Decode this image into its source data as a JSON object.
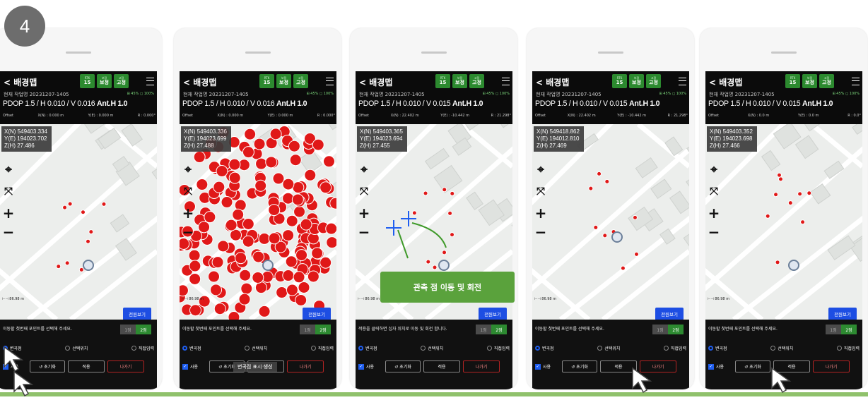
{
  "step_number": "4",
  "header": {
    "back_label": "< 배경맵",
    "chips": [
      {
        "top": "RTK",
        "value": "15"
      },
      {
        "top": "보정",
        "value": "보정"
      },
      {
        "top": "고정",
        "value": "고정"
      }
    ],
    "job_name": "현재 작업명 20231207-1405",
    "status_right": "⊞ 45%  ◻ 100%"
  },
  "panel": {
    "instruction": "이동할 첫번째 포인트를 선택해 주세요.",
    "instruction_alt": "적용을 클릭하면 십자 위치로 이동 및 회전 합니다.",
    "seg_1": "1점",
    "seg_2": "2점",
    "radio_1": "변곡점",
    "radio_2": "선택위치",
    "radio_3": "직접입력",
    "use_label": "사용",
    "reset_label": "↺ 초기화",
    "apply_label": "적용",
    "exit_label": "나가기"
  },
  "map": {
    "scale_text": "⊢⊣ 86.98 m",
    "full_view_label": "전원보기"
  },
  "annotation": {
    "move_rotate": "관측 점 이동 및 회전",
    "toast": "변곡점 표시 생성"
  },
  "screens": [
    {
      "pdop": "PDOP 1.5 / H 0.010 / V 0.016",
      "ant": "Ant.H 1.0",
      "offset": [
        "Offset",
        "X(N) : 0.000 m",
        "Y(E) : 0.000 m",
        "R : 0.000°"
      ],
      "coord": [
        "X(N) 549403.334",
        "Y(E) 194023.702",
        "Z(H) 27.486"
      ]
    },
    {
      "pdop": "PDOP 1.5 / H 0.010 / V 0.016",
      "ant": "Ant.H 1.0",
      "offset": [
        "Offset",
        "X(N) : 0.000 m",
        "Y(E) : 0.000 m",
        "R : 0.000°"
      ],
      "coord": [
        "X(N) 549403.336",
        "Y(E) 194023.699",
        "Z(H) 27.488"
      ]
    },
    {
      "pdop": "PDOP 1.5 / H 0.010 / V 0.015",
      "ant": "Ant.H 1.0",
      "offset": [
        "Offset",
        "X(N) : 22.402 m",
        "Y(E) : -10.442 m",
        "R : 21.298°"
      ],
      "coord": [
        "X(N) 549403.365",
        "Y(E) 194023.694",
        "Z(H) 27.455"
      ]
    },
    {
      "pdop": "PDOP 1.5 / H 0.010 / V 0.015",
      "ant": "Ant.H 1.0",
      "offset": [
        "Offset",
        "X(N) : 22.402 m",
        "Y(E) : -10.442 m",
        "R : 21.298°"
      ],
      "coord": [
        "X(N) 549418.862",
        "Y(E) 194012.810",
        "Z(H) 27.469"
      ]
    },
    {
      "pdop": "PDOP 1.5 / H 0.010 / V 0.015",
      "ant": "Ant.H 1.0",
      "offset": [
        "Offset",
        "X(N) : 0.0 m",
        "Y(E) : 0.0 m",
        "R : 0.0°"
      ],
      "coord": [
        "X(N) 549403.352",
        "Y(E) 194023.698",
        "Z(H) 27.466"
      ]
    }
  ],
  "colors": {
    "accent_green": "#2c8a2f",
    "point_red": "#e01818",
    "button_blue": "#1d4ee3",
    "annotation_green": "#5aa23c"
  }
}
